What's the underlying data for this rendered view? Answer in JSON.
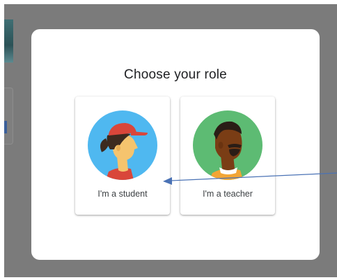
{
  "dialog": {
    "title": "Choose your role"
  },
  "roles": [
    {
      "label": "I'm a student",
      "icon": "student-avatar-icon"
    },
    {
      "label": "I'm a teacher",
      "icon": "teacher-avatar-icon"
    }
  ],
  "colors": {
    "overlay": "#7b7b7b",
    "student_bg": "#4fb8f0",
    "teacher_bg": "#5dbb73",
    "cap": "#d9463a",
    "arrow": "#4a72b5"
  }
}
